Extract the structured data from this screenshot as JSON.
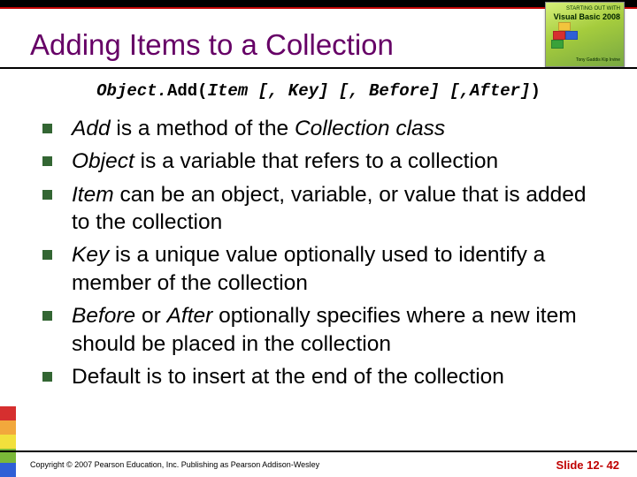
{
  "header": {
    "title": "Adding Items to a Collection"
  },
  "syntax": {
    "pre": "Object.",
    "method": "Add(",
    "item": "Item",
    "key": " [, Key]",
    "before": " [, Before]",
    "after": " [,After]",
    "close": ")"
  },
  "bullets": [
    {
      "lead": "Add",
      "rest": " is a method of the ",
      "tail_em": "Collection class",
      "tail": ""
    },
    {
      "lead": "Object",
      "rest": " is a variable that refers to a collection",
      "tail_em": "",
      "tail": ""
    },
    {
      "lead": "Item",
      "rest": " can be an object, variable, or value that is added to the collection",
      "tail_em": "",
      "tail": ""
    },
    {
      "lead": "Key",
      "rest": " is a unique value optionally used to identify a member of the collection",
      "tail_em": "",
      "tail": ""
    },
    {
      "lead": "Before",
      "mid": " or ",
      "lead2": "After",
      "rest": " optionally specifies where a new item should be placed in the collection",
      "tail_em": "",
      "tail": ""
    },
    {
      "lead": "",
      "rest": "Default is to insert at the end of the collection",
      "tail_em": "",
      "tail": ""
    }
  ],
  "footer": {
    "copyright": "Copyright © 2007 Pearson Education, Inc. Publishing as Pearson Addison-Wesley",
    "slide": "Slide 12- 42"
  },
  "book": {
    "line1": "STARTING OUT WITH",
    "line2": "Visual Basic 2008",
    "line3": "Tony Gaddis   Kip Irvine"
  }
}
